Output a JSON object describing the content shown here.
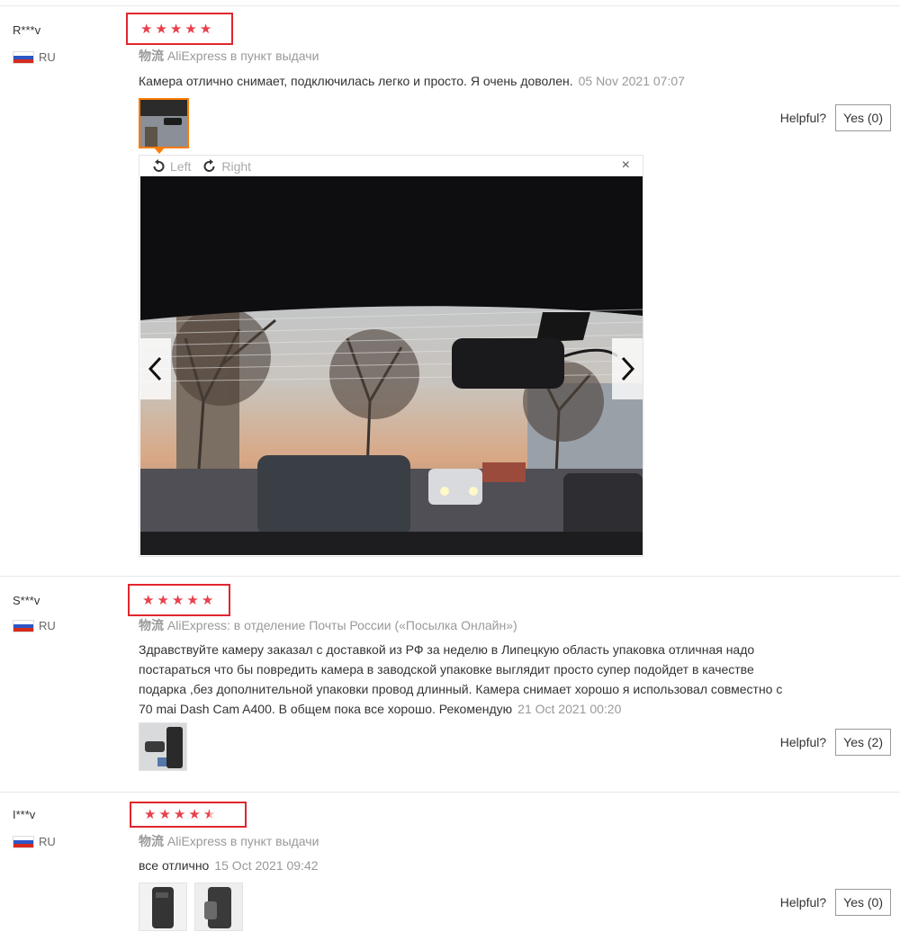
{
  "reviews": [
    {
      "user": "R***v",
      "country": "RU",
      "rating": 5,
      "logistics_label": "物流",
      "logistics": "AliExpress в пункт выдачи",
      "text": "Камера отлично снимает, подключилась легко и просто. Я очень доволен.",
      "date": "05 Nov 2021 07:07",
      "helpful_label": "Helpful?",
      "yes_label": "Yes (0)"
    },
    {
      "user": "S***v",
      "country": "RU",
      "rating": 5,
      "logistics_label": "物流",
      "logistics": "AliExpress: в отделение Почты России («Посылка Онлайн»)",
      "text_lines": [
        "Здравствуйте камеру заказал с доставкой из РФ за неделю в Липецкую область упаковка отличная надо",
        "постараться что бы повредить камера в заводской упаковке выглядит просто супер подойдет в качестве",
        "подарка ,без дополнительной упаковки провод длинный. Камера снимает хорошо я использовал совместно с",
        "70 mai Dash Cam A400. В общем пока все хорошо. Рекомендую"
      ],
      "date": "21 Oct 2021 00:20",
      "helpful_label": "Helpful?",
      "yes_label": "Yes (2)"
    },
    {
      "user": "I***v",
      "country": "RU",
      "rating": 4.5,
      "logistics_label": "物流",
      "logistics": "AliExpress в пункт выдачи",
      "text": "все отлично",
      "date": "15 Oct 2021 09:42",
      "helpful_label": "Helpful?",
      "yes_label": "Yes (0)"
    }
  ],
  "viewer": {
    "rotate_left": "Left",
    "rotate_right": "Right",
    "close": "×",
    "prev": "‹",
    "next": "›"
  },
  "colors": {
    "star": "#e8404c",
    "highlight_box": "#e0262d",
    "active_thumb": "#ff7a00"
  }
}
